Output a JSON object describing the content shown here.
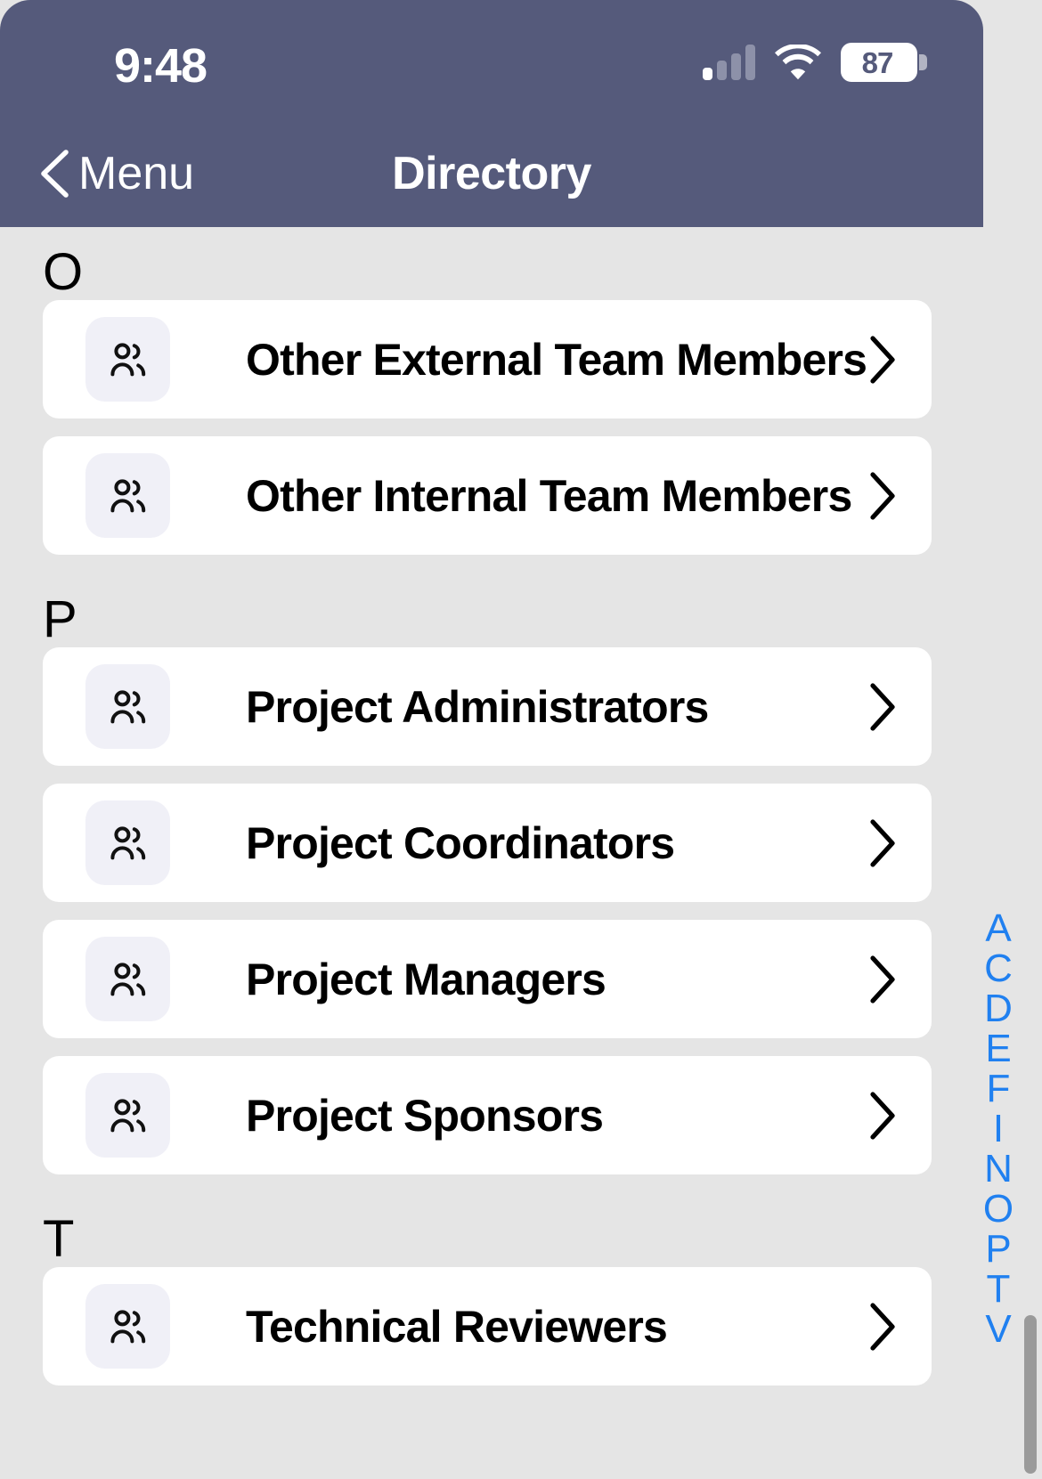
{
  "status_bar": {
    "time": "9:48",
    "signal_icon": "cellular-signal-icon",
    "signal_active_bars": 1,
    "signal_total_bars": 4,
    "wifi_icon": "wifi-icon",
    "battery_percent": "87",
    "battery_icon": "battery-icon"
  },
  "nav_bar": {
    "back_label": "Menu",
    "back_icon": "chevron-left-icon",
    "title": "Directory",
    "background_color": "#555a7b",
    "text_color": "#ffffff"
  },
  "colors": {
    "page_background": "#e5e5e5",
    "card_background": "#ffffff",
    "icon_tile_background": "#f0f0f7",
    "index_blue": "#2080f0",
    "scrollbar": "#9a9a9a"
  },
  "sections": [
    {
      "letter": "O",
      "items": [
        {
          "label": "Other External Team Members",
          "icon": "users-icon",
          "chevron": "chevron-right-icon"
        },
        {
          "label": "Other Internal Team Members",
          "icon": "users-icon",
          "chevron": "chevron-right-icon"
        }
      ]
    },
    {
      "letter": "P",
      "items": [
        {
          "label": "Project Administrators",
          "icon": "users-icon",
          "chevron": "chevron-right-icon"
        },
        {
          "label": "Project Coordinators",
          "icon": "users-icon",
          "chevron": "chevron-right-icon"
        },
        {
          "label": "Project Managers",
          "icon": "users-icon",
          "chevron": "chevron-right-icon"
        },
        {
          "label": "Project Sponsors",
          "icon": "users-icon",
          "chevron": "chevron-right-icon"
        }
      ]
    },
    {
      "letter": "T",
      "items": [
        {
          "label": "Technical Reviewers",
          "icon": "users-icon",
          "chevron": "chevron-right-icon"
        }
      ]
    }
  ],
  "alpha_index": [
    "A",
    "C",
    "D",
    "E",
    "F",
    "I",
    "N",
    "O",
    "P",
    "T",
    "V"
  ]
}
